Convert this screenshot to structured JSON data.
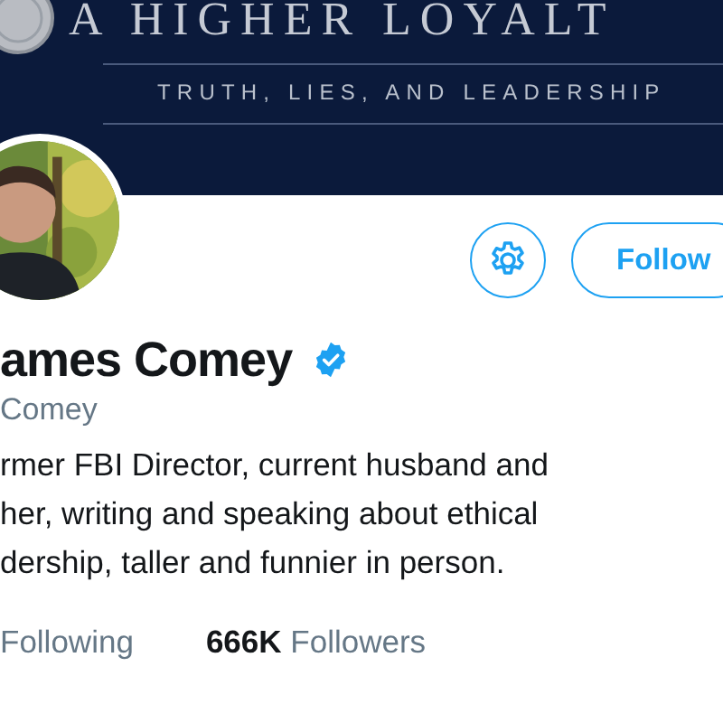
{
  "banner": {
    "title": "A HIGHER LOYALT",
    "subtitle": "TRUTH, LIES, AND LEADERSHIP"
  },
  "actions": {
    "follow_label": "Follow"
  },
  "profile": {
    "name": "ames Comey",
    "verified": true,
    "handle": "Comey",
    "bio": "rmer FBI Director, current husband and\nher, writing and speaking about ethical\ndership, taller and funnier in person."
  },
  "stats": [
    {
      "label": "Following"
    },
    {
      "count": "666K",
      "label": "Followers"
    }
  ]
}
